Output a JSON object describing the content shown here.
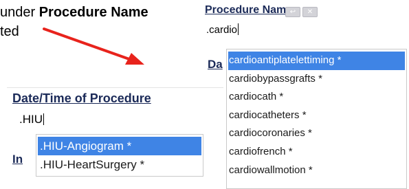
{
  "caption": {
    "prefix": "under ",
    "bold": "Procedure Name",
    "line2": "ted"
  },
  "procedure_panel": {
    "title": "Procedure Name",
    "input_value": ".cardio",
    "next_label_fragment": "Da",
    "suggestions": [
      "cardioantiplatelettiming *",
      "cardiobypassgrafts *",
      "cardiocath *",
      "cardiocatheters *",
      "cardiocoronaries *",
      "cardiofrench *",
      "cardiowallmotion *"
    ],
    "selected_index": 0
  },
  "datetime_panel": {
    "title": "Date/Time of Procedure",
    "input_value": ".HIU",
    "next_label_fragment": "In",
    "suggestions": [
      ".HIU-Angiogram *",
      ".HIU-HeartSurgery *"
    ],
    "selected_index": 0
  },
  "colors": {
    "selection": "#3f84e5",
    "heading": "#1b2a58",
    "arrow": "#e8231c"
  }
}
